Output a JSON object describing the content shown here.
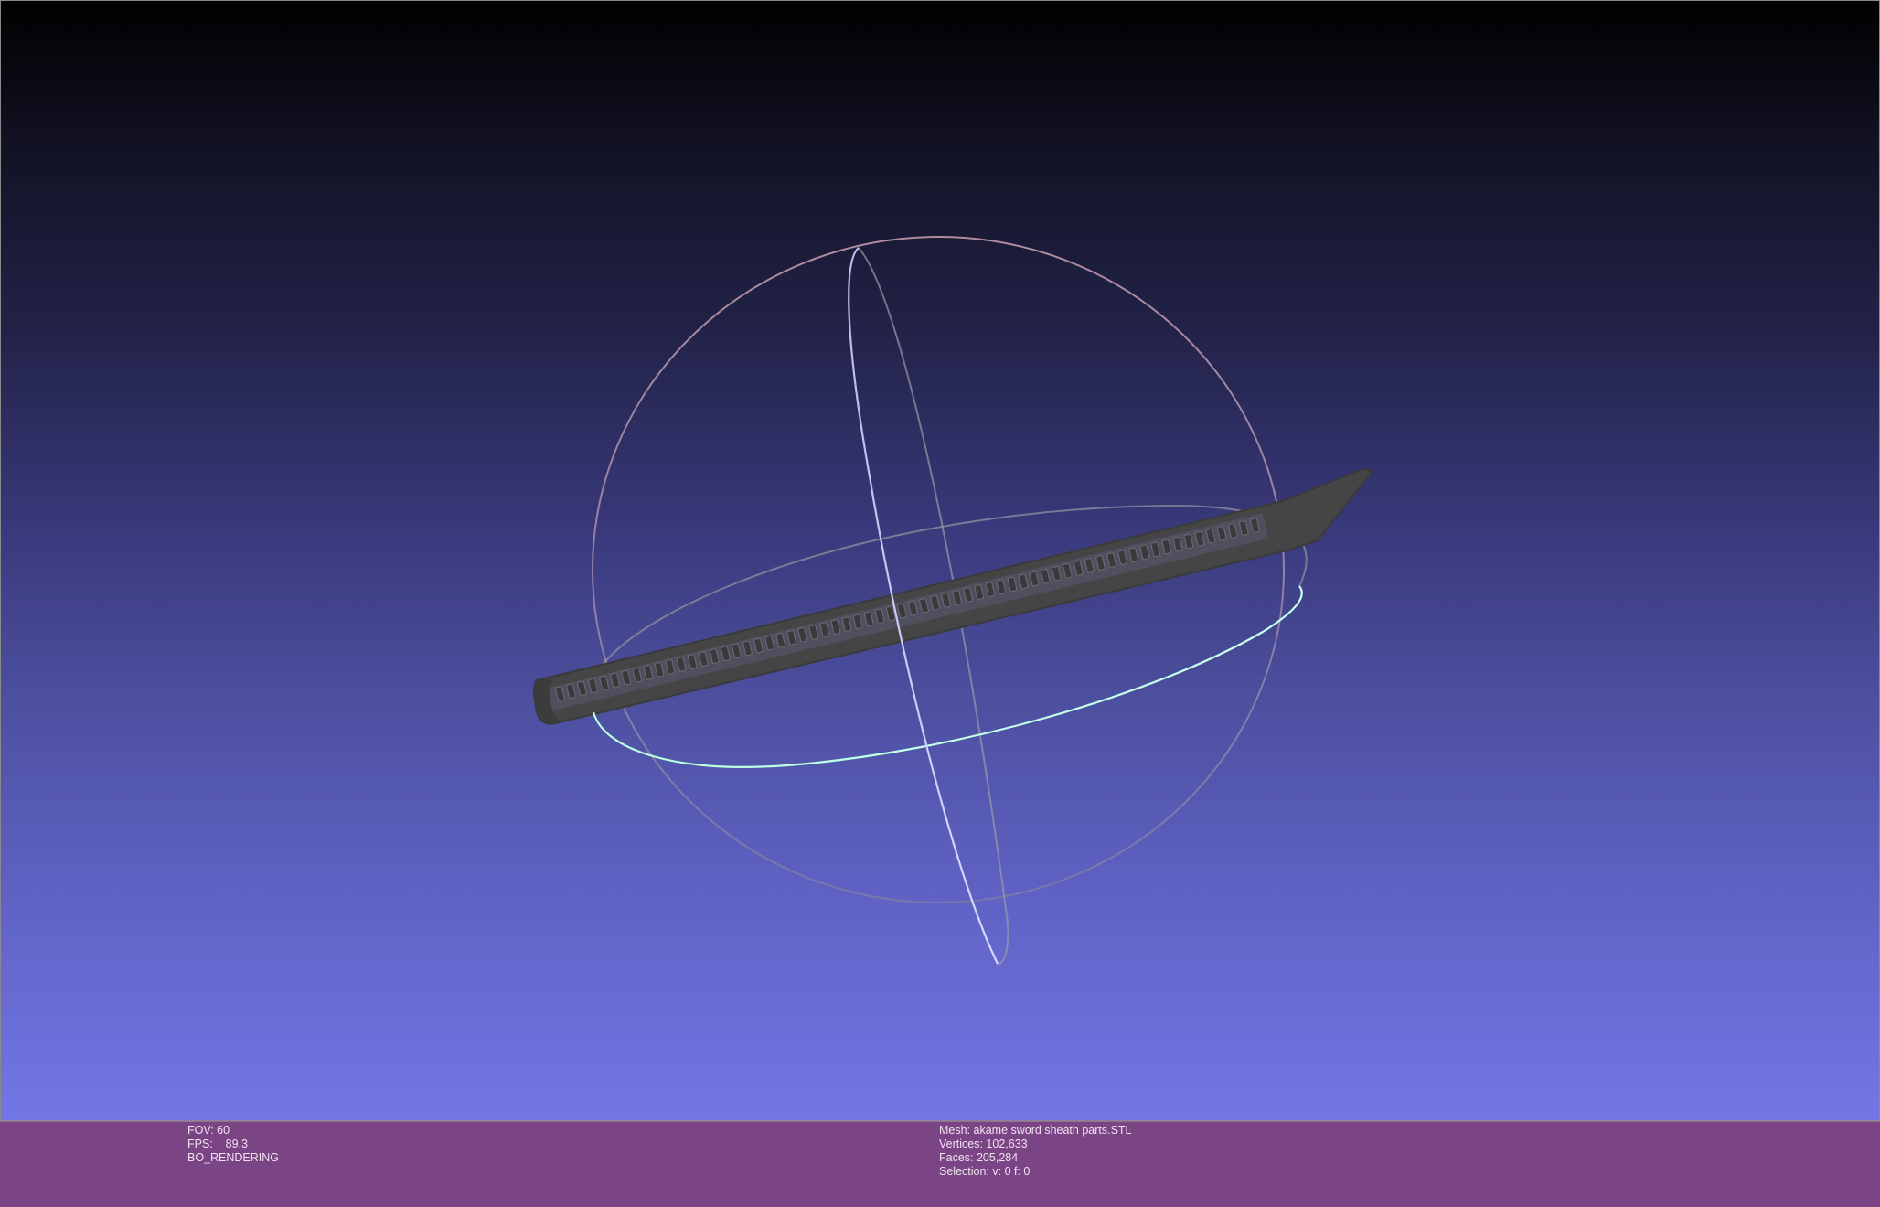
{
  "viewport": {
    "background_top": "#000000",
    "background_bottom": "#7476e6",
    "mesh_color": "#454545",
    "trackball_colors": {
      "horizontal_ring": "#a8f0d0",
      "vertical_ring": "#c8c8ff",
      "outer_ring": "#d0a8b0"
    }
  },
  "infobar": {
    "background": "#7b4585",
    "left": {
      "fov": "FOV: 60",
      "fps": "FPS:    89.3",
      "render_mode": "BO_RENDERING"
    },
    "right": {
      "mesh": "Mesh: akame sword sheath parts.STL",
      "vertices": "Vertices: 102,633",
      "faces": "Faces: 205,284",
      "selection": "Selection: v: 0 f: 0"
    }
  }
}
